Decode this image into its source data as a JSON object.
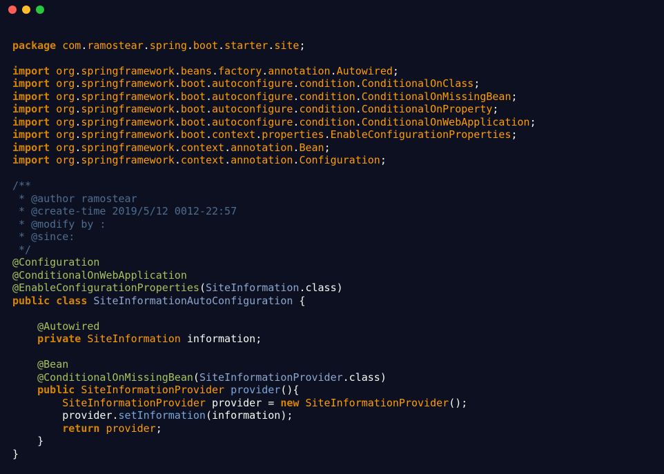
{
  "traffic": {
    "red": "#ff5f56",
    "yellow": "#ffbd2e",
    "green": "#27c93f"
  },
  "kw": {
    "package": "package",
    "import": "import",
    "public": "public",
    "private": "private",
    "class": "class",
    "new": "new",
    "return": "return"
  },
  "pkg": {
    "root": "com.ramostear.spring.boot.starter.site",
    "i1": "org.springframework.beans.factory.annotation.Autowired",
    "i2": "org.springframework.boot.autoconfigure.condition.ConditionalOnClass",
    "i3": "org.springframework.boot.autoconfigure.condition.ConditionalOnMissingBean",
    "i4": "org.springframework.boot.autoconfigure.condition.ConditionalOnProperty",
    "i5": "org.springframework.boot.autoconfigure.condition.ConditionalOnWebApplication",
    "i6": "org.springframework.boot.context.properties.EnableConfigurationProperties",
    "i7": "org.springframework.context.annotation.Bean",
    "i8": "org.springframework.context.annotation.Configuration"
  },
  "comment": {
    "l1": "/**",
    "l2": " * @author ramostear",
    "l3": " * @create-time 2019/5/12 0012-22:57",
    "l4": " * @modify by :",
    "l5": " * @since:",
    "l6": " */"
  },
  "ann": {
    "configuration": "@Configuration",
    "cowa": "@ConditionalOnWebApplication",
    "ecp": "@EnableConfigurationProperties",
    "autowired": "@Autowired",
    "bean": "@Bean",
    "comb": "@ConditionalOnMissingBean"
  },
  "cls": {
    "siteInfo": "SiteInformation",
    "main": "SiteInformationAutoConfiguration",
    "provider": "SiteInformationProvider"
  },
  "id": {
    "information": "information",
    "providerMethod": "provider",
    "providerVar": "provider",
    "setInformation": "setInformation"
  },
  "sym": {
    "dotClass": ".class",
    "semi": ";",
    "lp": "(",
    "rp": ")",
    "lb": "{",
    "rb": "}",
    "eq": " = ",
    "empty": "()"
  }
}
